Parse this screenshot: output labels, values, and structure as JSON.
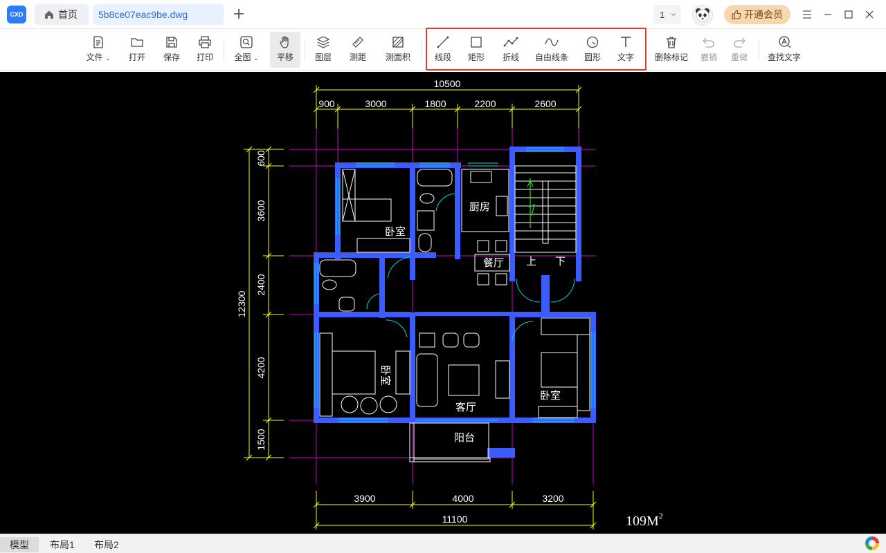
{
  "app": {
    "logo_text": "CXD",
    "home_tab": "首页",
    "file_tab": "5b8ce07eac9be.dwg",
    "page_number": "1",
    "vip_label": "开通会员"
  },
  "toolbar": {
    "file": "文件",
    "open": "打开",
    "save": "保存",
    "print": "打印",
    "fullview": "全图",
    "pan": "平移",
    "layers": "图层",
    "measure_dist": "测距",
    "measure_area": "测面积",
    "line": "线段",
    "rect": "矩形",
    "polyline": "折线",
    "freeline": "自由线条",
    "circle": "圆形",
    "text": "文字",
    "delete_marks": "删除标记",
    "undo": "撤销",
    "redo": "重做",
    "find_text": "查找文字"
  },
  "drawing": {
    "top_total": "10500",
    "top_dims": [
      "900",
      "3000",
      "1800",
      "2200",
      "2600"
    ],
    "left_total": "12300",
    "left_dims": [
      "600",
      "3600",
      "2400",
      "4200",
      "1500"
    ],
    "bottom_dims": [
      "3900",
      "4000",
      "3200"
    ],
    "bottom_total": "11100",
    "rooms": {
      "bedroom_1": "卧室",
      "kitchen": "厨房",
      "dining": "餐厅",
      "up": "上",
      "down": "下",
      "bedroom_2": "卧室",
      "living": "客厅",
      "bedroom_3": "卧室",
      "balcony": "阳台"
    },
    "area": "109M",
    "area_sup": "2"
  },
  "layout_tabs": [
    "模型",
    "布局1",
    "布局2"
  ],
  "colors": {
    "wall": "#3b5cff",
    "dim": "#ffff00",
    "axis": "#ff00ff",
    "door": "#00ffff",
    "background": "#000000"
  }
}
